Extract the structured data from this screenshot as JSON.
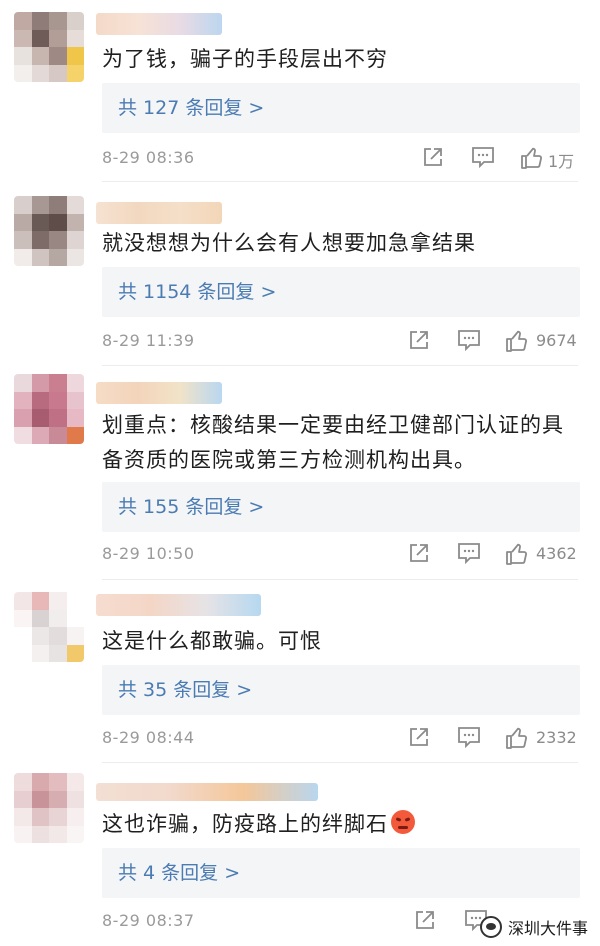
{
  "comments": [
    {
      "text": "为了钱，骗子的手段层出不穷",
      "replies_label": "共 127 条回复 >",
      "time": "8-29 08:36",
      "likes": "1万",
      "avatar_colors": [
        "#bfa9a2",
        "#8f7c78",
        "#a89690",
        "#d9cfcb",
        "#ccb8b2",
        "#6f5c58",
        "#b39d97",
        "#e6dcd8",
        "#e8e2df",
        "#c7b6b0",
        "#9e8985",
        "#f0c64a",
        "#f3efed",
        "#e3d9d6",
        "#d6c9c5",
        "#f6d36a"
      ],
      "name_colors": [
        "#f4d9c8",
        "#f7e2d6",
        "#e9dbe4",
        "#bcd6ef"
      ]
    },
    {
      "text": "就没想想为什么会有人想要加急拿结果",
      "replies_label": "共 1154 条回复 >",
      "time": "8-29 11:39",
      "likes": "9674",
      "avatar_colors": [
        "#d8cfcc",
        "#a89893",
        "#8e7d78",
        "#e4dbd8",
        "#b9aaa5",
        "#6a5a55",
        "#5e4d48",
        "#c2b3ae",
        "#cbbfbb",
        "#7d6c67",
        "#988782",
        "#ded4d1",
        "#f1ece9",
        "#cfc4c0",
        "#b5a7a2",
        "#ebe5e3"
      ],
      "name_colors": [
        "#f6e2d2",
        "#f2d8bf",
        "#f5dfc9",
        "#f3d6b8"
      ]
    },
    {
      "text": "划重点：核酸结果一定要由经卫健部门认证的具备资质的医院或第三方检测机构出具。",
      "replies_label": "共 155 条回复 >",
      "time": "8-29 10:50",
      "likes": "4362",
      "avatar_colors": [
        "#e9d9dd",
        "#d59aa7",
        "#c97f90",
        "#eed8de",
        "#e2b3bf",
        "#b86a7e",
        "#c9798d",
        "#e7c3cd",
        "#d9a1b0",
        "#a85c70",
        "#bf7084",
        "#e6b9c4",
        "#f0dde2",
        "#dcaab7",
        "#c98a98",
        "#e07a4a"
      ],
      "name_colors": [
        "#f6dcc6",
        "#f3d4bb",
        "#f1e3c8",
        "#b9d7f1"
      ]
    },
    {
      "text": "这是什么都敢骗。可恨",
      "replies_label": "共 35 条回复 >",
      "time": "8-29 08:44",
      "likes": "2332",
      "avatar_colors": [
        "#f3e6e6",
        "#e8b8b8",
        "#f4eeee",
        "#ffffff",
        "#fbf4f4",
        "#d9d2d2",
        "#f1eded",
        "#ffffff",
        "#ffffff",
        "#ece7e7",
        "#e2dcdc",
        "#f7f3f3",
        "#ffffff",
        "#f4f0f0",
        "#e8e3e3",
        "#f1c86a"
      ],
      "name_colors": [
        "#f6ddd0",
        "#f4d6c6",
        "#e6e3e6",
        "#b6d8f0"
      ]
    },
    {
      "text": "这也诈骗，防疫路上的绊脚石",
      "replies_label": "共 4 条回复 >",
      "time": "8-29 08:37",
      "likes": "",
      "avatar_colors": [
        "#eedcdc",
        "#d8a9ad",
        "#e2bcbf",
        "#f4e8e8",
        "#e7cfd1",
        "#c99499",
        "#d6aeb1",
        "#efe0e1",
        "#f3e9e9",
        "#dfc3c5",
        "#e9d4d5",
        "#f7efef",
        "#f8f2f2",
        "#ece0e1",
        "#f2e8e8",
        "#faf5f5"
      ],
      "name_colors": [
        "#f3dfd4",
        "#f2d9cb",
        "#f4c79a",
        "#b8d6ee"
      ]
    }
  ],
  "watermark": {
    "text": "深圳大件事",
    "icon": "wechat-icon"
  },
  "colors": {
    "link": "#4a7bb3",
    "meta": "#9a9a9a",
    "reply_bg": "#f4f5f6"
  }
}
